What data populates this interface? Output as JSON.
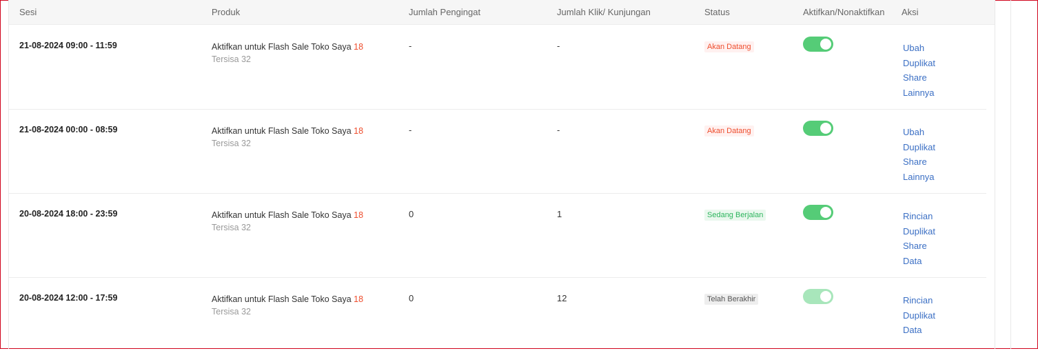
{
  "headers": {
    "sesi": "Sesi",
    "produk": "Produk",
    "pengingat": "Jumlah Pengingat",
    "klik": "Jumlah Klik/ Kunjungan",
    "status": "Status",
    "aktifkan": "Aktifkan/Nonaktifkan",
    "aksi": "Aksi"
  },
  "rows": [
    {
      "sesi": "21-08-2024 09:00 - 11:59",
      "produk": "Aktifkan untuk Flash Sale Toko Saya",
      "produk_count": "18",
      "tersisa": "Tersisa 32",
      "pengingat": "-",
      "klik": "-",
      "status": "Akan Datang",
      "enabled": true,
      "actions": [
        "Ubah",
        "Duplikat",
        "Share",
        "Lainnya"
      ]
    },
    {
      "sesi": "21-08-2024 00:00 - 08:59",
      "produk": "Aktifkan untuk Flash Sale Toko Saya",
      "produk_count": "18",
      "tersisa": "Tersisa 32",
      "pengingat": "-",
      "klik": "-",
      "status": "Akan Datang",
      "enabled": true,
      "actions": [
        "Ubah",
        "Duplikat",
        "Share",
        "Lainnya"
      ]
    },
    {
      "sesi": "20-08-2024 18:00 - 23:59",
      "produk": "Aktifkan untuk Flash Sale Toko Saya",
      "produk_count": "18",
      "tersisa": "Tersisa 32",
      "pengingat": "0",
      "klik": "1",
      "status": "Sedang Berjalan",
      "enabled": true,
      "actions": [
        "Rincian",
        "Duplikat",
        "Share",
        "Data"
      ]
    },
    {
      "sesi": "20-08-2024 12:00 - 17:59",
      "produk": "Aktifkan untuk Flash Sale Toko Saya",
      "produk_count": "18",
      "tersisa": "Tersisa 32",
      "pengingat": "0",
      "klik": "12",
      "status": "Telah Berakhir",
      "enabled": true,
      "actions": [
        "Rincian",
        "Duplikat",
        "Data"
      ]
    }
  ]
}
